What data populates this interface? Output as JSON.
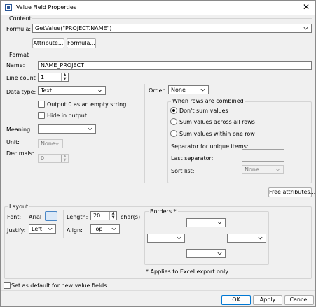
{
  "window": {
    "title": "Value Field Properties",
    "close_glyph": "✕"
  },
  "content": {
    "group_title": "Content",
    "formula_label": "Formula:",
    "formula_value": "GetValue(\"PROJECT.NAME\")",
    "attribute_button": "Attribute...",
    "formula_button": "Formula..."
  },
  "format": {
    "group_title": "Format",
    "name_label": "Name:",
    "name_value": "NAME_PROJECT",
    "line_count_label": "Line count",
    "line_count_value": "1",
    "data_type_label": "Data type:",
    "data_type_value": "Text",
    "output_zero_label": "Output 0 as an empty string",
    "hide_output_label": "Hide in output",
    "meaning_label": "Meaning:",
    "meaning_value": "",
    "unit_label": "Unit:",
    "unit_value": "None",
    "decimals_label": "Decimals:",
    "decimals_value": "0",
    "order_label": "Order:",
    "order_value": "None",
    "combined_title": "When rows are combined",
    "radio_dont_sum": "Don't sum values",
    "radio_across_rows": "Sum values across all rows",
    "radio_within_row": "Sum values within one row",
    "separator_unique_label": "Separator for unique items:",
    "last_separator_label": "Last separator:",
    "sort_list_label": "Sort list:",
    "sort_list_value": "None",
    "free_attributes_button": "Free attributes..."
  },
  "layout": {
    "group_title": "Layout",
    "font_label": "Font:",
    "font_value": "Arial",
    "font_button": "...",
    "length_label": "Length:",
    "length_value": "20",
    "length_unit": "char(s)",
    "justify_label": "Justify:",
    "justify_value": "Left",
    "align_label": "Align:",
    "align_value": "Top",
    "borders_title": "Borders *",
    "borders_note": "* Applies to Excel export only"
  },
  "footer": {
    "default_checkbox_label": "Set as default for new value fields",
    "ok_button": "OK",
    "apply_button": "Apply",
    "cancel_button": "Cancel"
  },
  "colors": {
    "accent": "#0078d4",
    "window_bg": "#f0f0f0"
  }
}
